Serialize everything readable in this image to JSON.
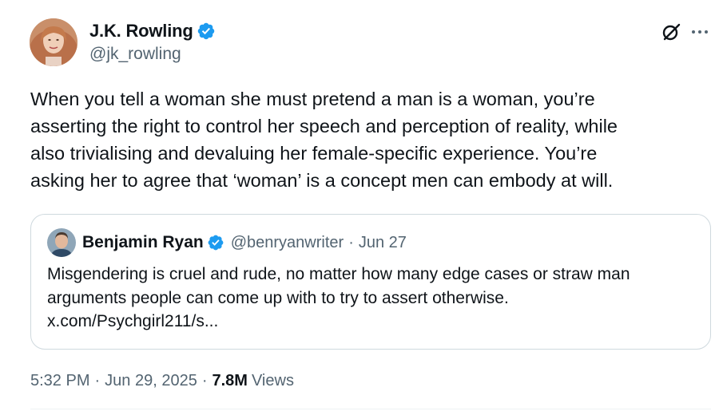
{
  "author": {
    "name": "J.K. Rowling",
    "handle": "@jk_rowling",
    "verified": true
  },
  "icons": {
    "verified": "verified-badge-icon",
    "grok": "grok-icon",
    "more": "more-options-icon"
  },
  "tweet": {
    "lines": [
      "When you tell a woman she must pretend a man is a woman, you’re",
      "asserting the right to control her speech and perception of reality, while",
      "also trivialising and devaluing her female-specific experience. You’re",
      "asking her to agree that ‘woman’ is a concept men can embody at will."
    ]
  },
  "quote": {
    "name": "Benjamin Ryan",
    "handle": "@benryanwriter",
    "separator": "·",
    "date": "Jun 27",
    "lines": [
      "Misgendering is cruel and rude, no matter how many edge cases or straw man",
      "arguments people can come up with to try to assert otherwise.",
      "x.com/Psychgirl211/s..."
    ]
  },
  "footer": {
    "time": "5:32 PM",
    "separator": "·",
    "date": "Jun 29, 2025",
    "views_count": "7.8M",
    "views_label": "Views"
  },
  "colors": {
    "text_primary": "#0f1419",
    "text_secondary": "#536471",
    "verified_blue": "#1d9bf0",
    "border": "#cfd9de"
  }
}
